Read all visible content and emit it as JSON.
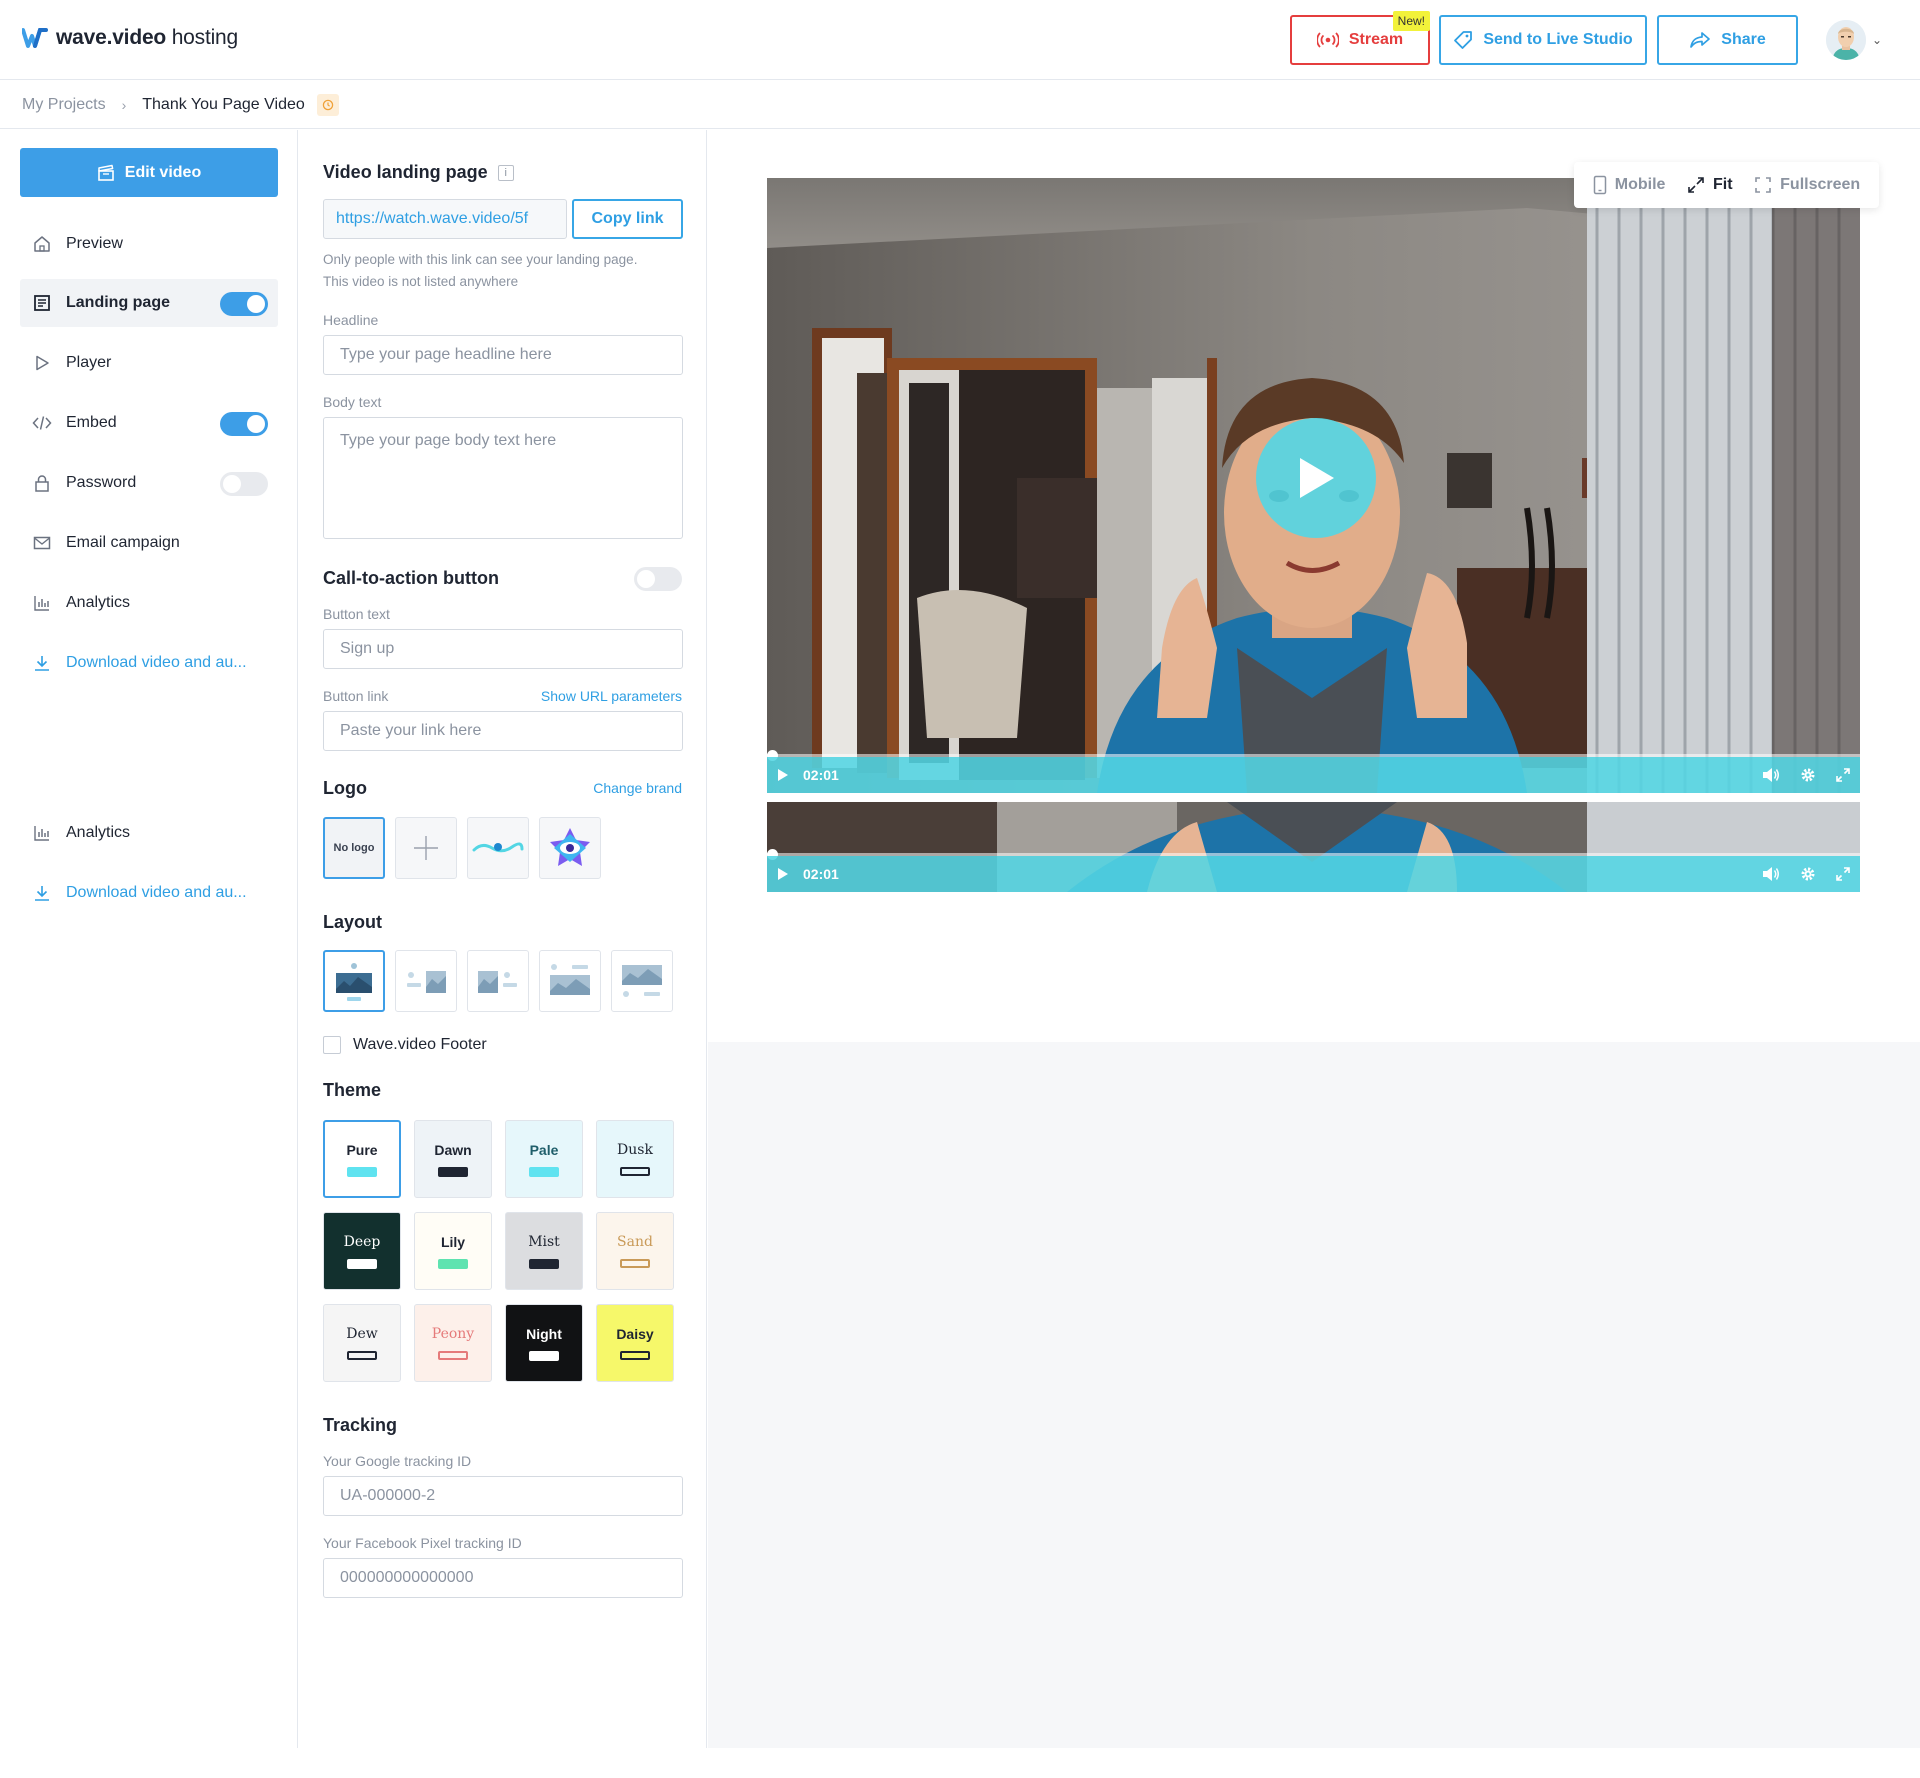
{
  "app": {
    "brand_bold": "wave.video",
    "brand_light": " hosting"
  },
  "header": {
    "stream_label": "Stream",
    "stream_badge": "New!",
    "live_studio_label": "Send to Live Studio",
    "share_label": "Share",
    "accent_color": "#2f9fe3",
    "stream_color": "#e53e3e"
  },
  "breadcrumb": {
    "parent": "My Projects",
    "current": "Thank You Page Video"
  },
  "sidebar": {
    "edit_button": "Edit video",
    "items": [
      {
        "label": "Preview",
        "icon": "home-icon"
      },
      {
        "label": "Landing page",
        "icon": "page-icon",
        "toggle": true,
        "active": true
      },
      {
        "label": "Player",
        "icon": "play-outline-icon"
      },
      {
        "label": "Embed",
        "icon": "code-icon",
        "toggle": true
      },
      {
        "label": "Password",
        "icon": "lock-icon",
        "toggle": false
      },
      {
        "label": "Email campaign",
        "icon": "mail-icon"
      },
      {
        "label": "Analytics",
        "icon": "bar-chart-icon"
      },
      {
        "label": "Download video and au...",
        "icon": "download-icon"
      },
      {
        "label": "Analytics",
        "icon": "bar-chart-icon"
      },
      {
        "label": "Download video and au...",
        "icon": "download-icon"
      }
    ]
  },
  "landing": {
    "title": "Video landing page",
    "url_value": "https://watch.wave.video/5f",
    "copy_link": "Copy link",
    "note_line1": "Only people with this link can see your landing page.",
    "note_line2": "This video is not listed anywhere",
    "headline_label": "Headline",
    "headline_placeholder": "Type your page headline here",
    "body_label": "Body text",
    "body_placeholder": "Type your page body text here"
  },
  "cta": {
    "title": "Call-to-action button",
    "enabled": false,
    "button_text_label": "Button text",
    "button_text_placeholder": "Sign up",
    "button_link_label": "Button link",
    "show_params": "Show URL parameters",
    "button_link_placeholder": "Paste your link here"
  },
  "logo": {
    "title": "Logo",
    "change_brand": "Change brand",
    "no_logo": "No logo"
  },
  "layout": {
    "title": "Layout",
    "footer_label": "Wave.video Footer",
    "footer_checked": false
  },
  "theme": {
    "title": "Theme",
    "selected": "Pure",
    "items": [
      {
        "name": "Pure",
        "bg": "#ffffff",
        "fg": "#1f2532",
        "swatch": "#5fe3f0"
      },
      {
        "name": "Dawn",
        "bg": "#eef3f7",
        "fg": "#1f2532",
        "swatch": "#1f2532"
      },
      {
        "name": "Pale",
        "bg": "#e6f7fb",
        "fg": "#1f5e6a",
        "swatch": "#5fe3f0"
      },
      {
        "name": "Dusk",
        "bg": "#e6f7fb",
        "fg": "#1f2532",
        "swatch": "#1f2532",
        "outline": true,
        "serif": true
      },
      {
        "name": "Deep",
        "bg": "#12302e",
        "fg": "#ffffff",
        "swatch": "#ffffff",
        "serif": true
      },
      {
        "name": "Lily",
        "bg": "#fffdf6",
        "fg": "#1f2532",
        "swatch": "#5fe3b0"
      },
      {
        "name": "Mist",
        "bg": "#dcdde0",
        "fg": "#1f2532",
        "swatch": "#1f2532",
        "serif": true
      },
      {
        "name": "Sand",
        "bg": "#fcf5ec",
        "fg": "#c99a58",
        "swatch": "#c99a58",
        "outline": true,
        "serif": true
      },
      {
        "name": "Dew",
        "bg": "#f5f5f5",
        "fg": "#1f2532",
        "swatch": "#1f2532",
        "outline": true,
        "serif": true
      },
      {
        "name": "Peony",
        "bg": "#fdf0ea",
        "fg": "#e57a7a",
        "swatch": "#e57a7a",
        "outline": true,
        "serif": true
      },
      {
        "name": "Night",
        "bg": "#111214",
        "fg": "#ffffff",
        "swatch": "#ffffff"
      },
      {
        "name": "Daisy",
        "bg": "#f6f86a",
        "fg": "#1f2532",
        "swatch": "#1f2532",
        "outline": true
      }
    ]
  },
  "tracking": {
    "title": "Tracking",
    "google_label": "Your Google tracking ID",
    "google_placeholder": "UA-000000-2",
    "facebook_label": "Your Facebook Pixel tracking ID",
    "facebook_placeholder": "000000000000000"
  },
  "preview": {
    "view_mobile": "Mobile",
    "view_fit": "Fit",
    "view_fullscreen": "Fullscreen",
    "active_view": "Fit",
    "time_main": "02:01",
    "time_second": "02:01",
    "player_color": "#53d6e4"
  }
}
